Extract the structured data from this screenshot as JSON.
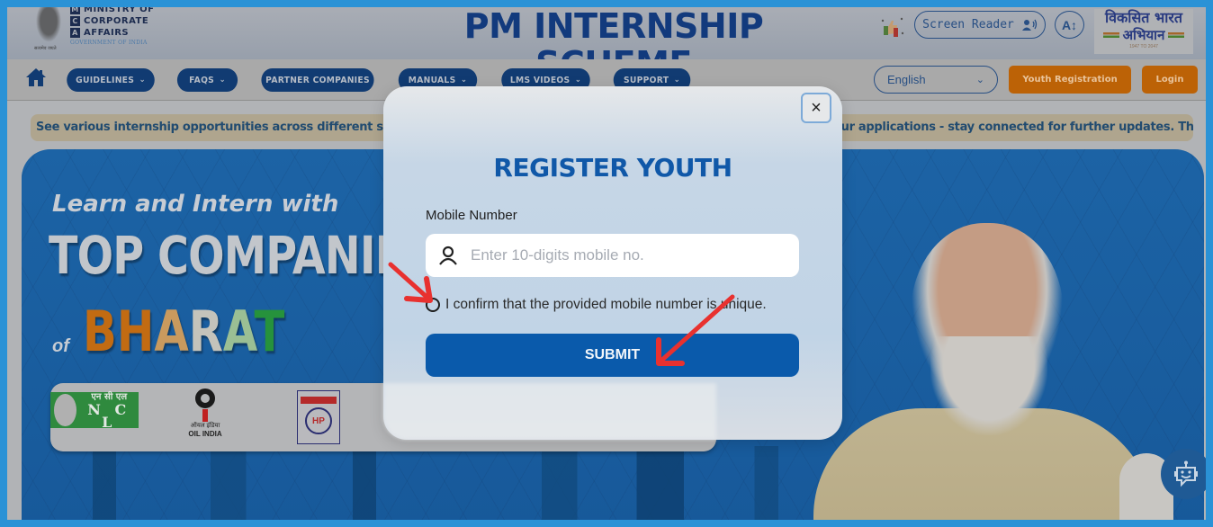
{
  "header": {
    "ministry_lines": [
      "MINISTRY OF",
      "CORPORATE",
      "AFFAIRS"
    ],
    "ministry_initials": [
      "M",
      "C",
      "A"
    ],
    "government_label": "GOVERNMENT OF INDIA",
    "emblem_caption": "सत्यमेव जयते",
    "site_title": "PM INTERNSHIP SCHEME",
    "screen_reader_label": "Screen Reader",
    "font_size_label": "A↕",
    "viksit_bharat": {
      "line1": "विकसित भारत",
      "line2": "अभियान",
      "line3": "1947 TO 2047"
    }
  },
  "nav": {
    "items": [
      {
        "label": "GUIDELINES",
        "has_dropdown": true
      },
      {
        "label": "FAQS",
        "has_dropdown": true
      },
      {
        "label": "PARTNER COMPANIES",
        "has_dropdown": false
      },
      {
        "label": "MANUALS",
        "has_dropdown": true
      },
      {
        "label": "LMS VIDEOS",
        "has_dropdown": true
      },
      {
        "label": "SUPPORT",
        "has_dropdown": true
      }
    ],
    "language_selected": "English",
    "youth_registration_label": "Youth Registration",
    "login_label": "Login",
    "chevron": "⌄"
  },
  "marquee": {
    "text": "See various internship opportunities across different sectors ... your applications - stay connected for further updates. The",
    "visible_left": "See various internship opportunities across different sec",
    "visible_right": "our applications - stay connected for further updates. The"
  },
  "hero": {
    "subtitle": "Learn and Intern with",
    "headline": "TOP COMPANIES",
    "of_label": "of",
    "bharat_letters": [
      "B",
      "H",
      "A",
      "R",
      "A",
      "T"
    ],
    "partner_logos": [
      {
        "name": "NCL",
        "hindi": "एन सी एल",
        "english": "N C L"
      },
      {
        "name": "Oil India",
        "hindi": "ऑयल इंडिया",
        "english": "OIL INDIA"
      },
      {
        "name": "HP",
        "english": "HP"
      }
    ]
  },
  "modal": {
    "title": "REGISTER YOUTH",
    "close_label": "×",
    "mobile_label": "Mobile Number",
    "mobile_value": "",
    "mobile_placeholder": "Enter 10-digits mobile no.",
    "confirm_label": "I confirm that the provided mobile number is unique.",
    "confirm_checked": false,
    "submit_label": "SUBMIT"
  },
  "colors": {
    "brand_blue": "#1058a8",
    "nav_blue": "#113b72",
    "orange": "#bc6206",
    "annotation_red": "#e8312f"
  }
}
